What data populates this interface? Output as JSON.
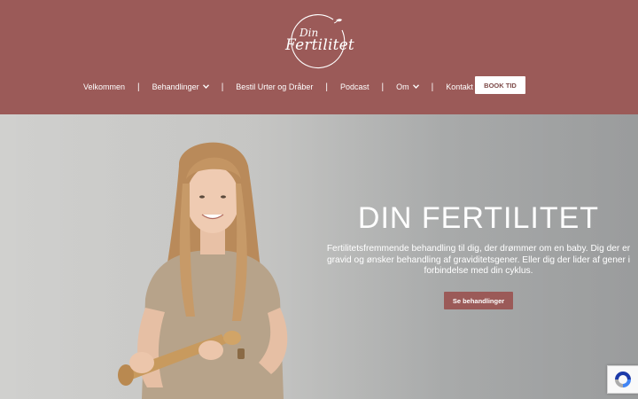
{
  "logo": {
    "small_text": "Din",
    "name": "Fertilitet"
  },
  "nav": {
    "items": [
      {
        "label": "Velkommen",
        "has_dropdown": false
      },
      {
        "label": "Behandlinger",
        "has_dropdown": true
      },
      {
        "label": "Bestil Urter og Dråber",
        "has_dropdown": false
      },
      {
        "label": "Podcast",
        "has_dropdown": false
      },
      {
        "label": "Om",
        "has_dropdown": true
      },
      {
        "label": "Kontakt",
        "has_dropdown": false
      }
    ],
    "separator": "|",
    "chevron": "⌄"
  },
  "book_button": {
    "label": "BOOK TID"
  },
  "hero": {
    "title": "DIN FERTILITET",
    "text": "Fertilitetsfremmende behandling til dig, der drømmer om en baby. Dig der er gravid og ønsker behandling af graviditetsgener. Eller dig der lider af gener i forbindelse med din cyklus.",
    "button_label": "Se behandlinger"
  },
  "colors": {
    "brand": "#9b5a58",
    "white": "#ffffff",
    "hero_bg": "#cfcfcd"
  },
  "icons": {
    "recaptcha": "recaptcha-icon",
    "dropdown": "chevron-down-icon"
  }
}
